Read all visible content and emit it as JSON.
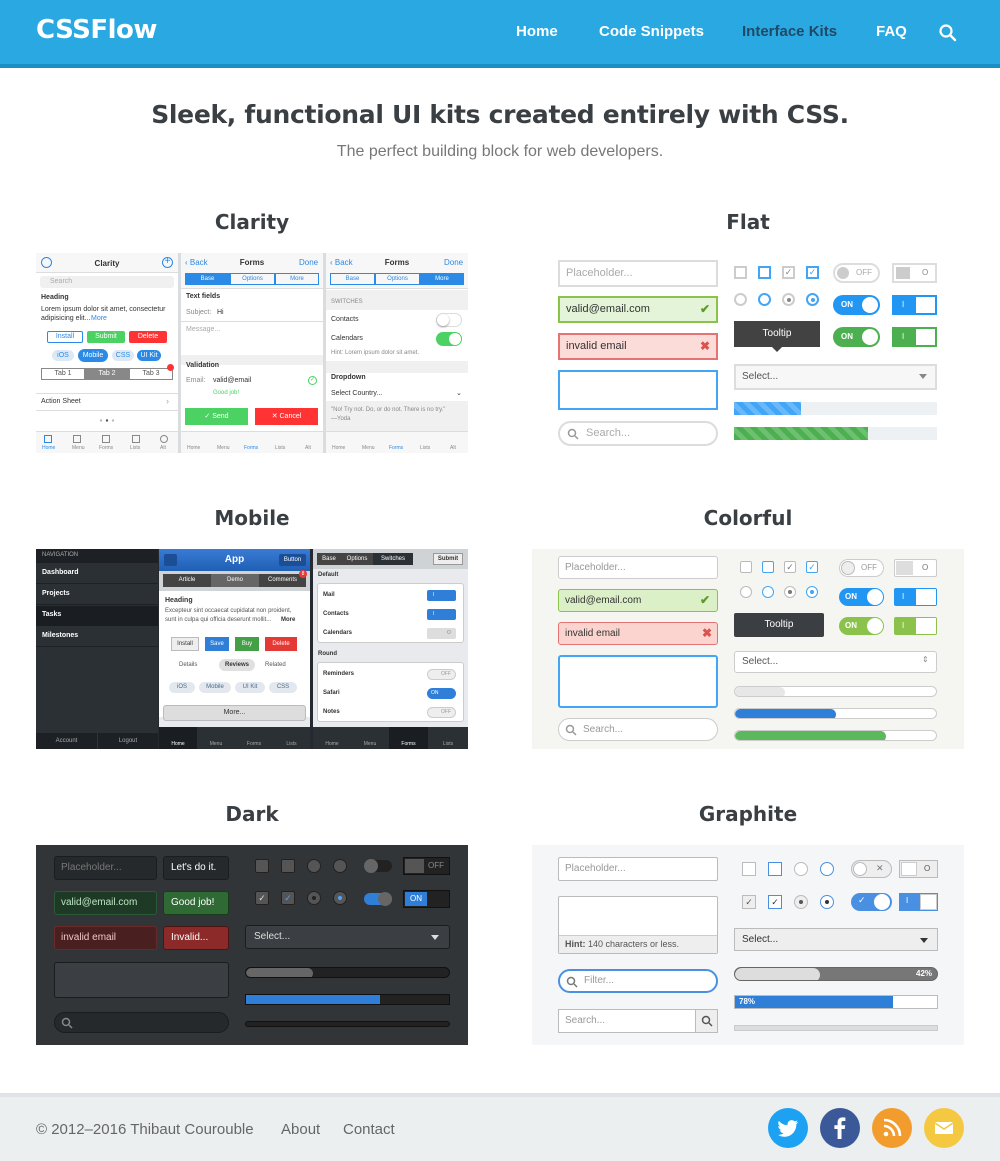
{
  "header": {
    "logo": "CSSFlow",
    "nav": [
      {
        "label": "Home"
      },
      {
        "label": "Code Snippets"
      },
      {
        "label": "Interface Kits"
      },
      {
        "label": "FAQ"
      }
    ],
    "search_icon": "search-icon"
  },
  "hero": {
    "headline": "Sleek, functional UI kits created entirely with CSS.",
    "subheadline": "The perfect building block for web developers."
  },
  "kits": [
    {
      "title": "Clarity"
    },
    {
      "title": "Flat"
    },
    {
      "title": "Mobile"
    },
    {
      "title": "Colorful"
    },
    {
      "title": "Dark"
    },
    {
      "title": "Graphite"
    }
  ],
  "clarity": {
    "s1": {
      "title": "Clarity",
      "search": "Search",
      "heading": "Heading",
      "lorem": "Lorem ipsum dolor sit amet, consectetur",
      "lorem2": "adipisicing elit...",
      "more": "More",
      "install": "Install",
      "submit": "Submit",
      "delete": "Delete",
      "tags": [
        "iOS",
        "Mobile",
        "CSS",
        "UI Kit"
      ],
      "tabs": [
        "Tab 1",
        "Tab 2",
        "Tab 3"
      ],
      "action": "Action Sheet"
    },
    "s2": {
      "back": "Back",
      "title": "Forms",
      "done": "Done",
      "seg": [
        "Base",
        "Options",
        "More"
      ],
      "section": "Text fields",
      "subject_label": "Subject:",
      "subject_val": "Hi",
      "message": "Message...",
      "validation": "Validation",
      "email_label": "Email:",
      "email_val": "valid@email",
      "good": "Good job!",
      "send": "Send",
      "cancel": "Cancel"
    },
    "s3": {
      "back": "Back",
      "title": "Forms",
      "done": "Done",
      "seg": [
        "Base",
        "Options",
        "More"
      ],
      "switches": "SWITCHES",
      "contacts": "Contacts",
      "calendars": "Calendars",
      "hint": "Hint: Lorem ipsum dolor sit amet.",
      "dropdown": "Dropdown",
      "select": "Select Country...",
      "quote": "\"No! Try not. Do, or do not. There is no try.\"",
      "quote_by": "—Yoda"
    },
    "tabbar": [
      "Home",
      "Menu",
      "Forms",
      "Lists",
      "Alt"
    ]
  },
  "flat": {
    "placeholder": "Placeholder...",
    "valid": "valid@email.com",
    "invalid": "invalid email",
    "search": "Search...",
    "off": "OFF",
    "on": "ON",
    "o": "O",
    "i": "I",
    "tooltip": "Tooltip",
    "select": "Select...",
    "progress": [
      0.33,
      0.66
    ]
  },
  "mobile": {
    "navigation": "NAVIGATION",
    "menu": [
      "Dashboard",
      "Projects",
      "Tasks",
      "Milestones"
    ],
    "account": "Account",
    "logout": "Logout",
    "app": "App",
    "button": "Button",
    "tabs": [
      "Article",
      "Demo",
      "Comments"
    ],
    "badge": "8",
    "heading": "Heading",
    "text1": "Excepteur sint occaecat cupidatat non proident,",
    "text2": "sunt in culpa qui officia deserunt mollit...",
    "more": "More",
    "btns": [
      "Install",
      "Save",
      "Buy",
      "Delete"
    ],
    "subtabs": [
      "Details",
      "Reviews",
      "Related"
    ],
    "tags": [
      "iOS",
      "Mobile",
      "UI Kit",
      "CSS"
    ],
    "more_btn": "More...",
    "tabbar": [
      "Home",
      "Menu",
      "Forms",
      "Lists"
    ],
    "seg": [
      "Base",
      "Options",
      "Switches"
    ],
    "submit": "Submit",
    "default": "Default",
    "rows1": [
      "Mail",
      "Contacts",
      "Calendars"
    ],
    "round": "Round",
    "rows2": [
      "Reminders",
      "Safari",
      "Notes"
    ],
    "off": "OFF",
    "on": "ON",
    "i": "I",
    "o": "O"
  },
  "colorful": {
    "placeholder": "Placeholder...",
    "valid": "valid@email.com",
    "invalid": "invalid email",
    "search": "Search...",
    "off": "OFF",
    "on": "ON",
    "o": "O",
    "i": "I",
    "tooltip": "Tooltip",
    "select": "Select...",
    "progress": [
      0.25,
      0.5,
      0.75
    ]
  },
  "dark": {
    "placeholder": "Placeholder...",
    "letsdo": "Let's do it.",
    "valid": "valid@email.com",
    "good": "Good job!",
    "invalid": "invalid email",
    "invalid2": "Invalid...",
    "off": "OFF",
    "on": "ON",
    "select": "Select...",
    "progress": [
      0.33,
      0.66
    ]
  },
  "graphite": {
    "placeholder": "Placeholder...",
    "hint_label": "Hint:",
    "hint": "140 characters or less.",
    "filter": "Filter...",
    "search": "Search...",
    "o": "O",
    "i": "I",
    "select": "Select...",
    "p1": "42%",
    "p2": "78%",
    "progress": [
      0.42,
      0.78
    ]
  },
  "footer": {
    "copyright": "© 2012–2016 Thibaut Courouble",
    "about": "About",
    "contact": "Contact",
    "social": [
      "twitter-icon",
      "facebook-icon",
      "rss-icon",
      "mail-icon"
    ]
  },
  "colors": {
    "brand": "#29a8e2",
    "twitter": "#1da1f2",
    "facebook": "#3b5998",
    "rss": "#f39c2e",
    "mail": "#f5c842"
  }
}
